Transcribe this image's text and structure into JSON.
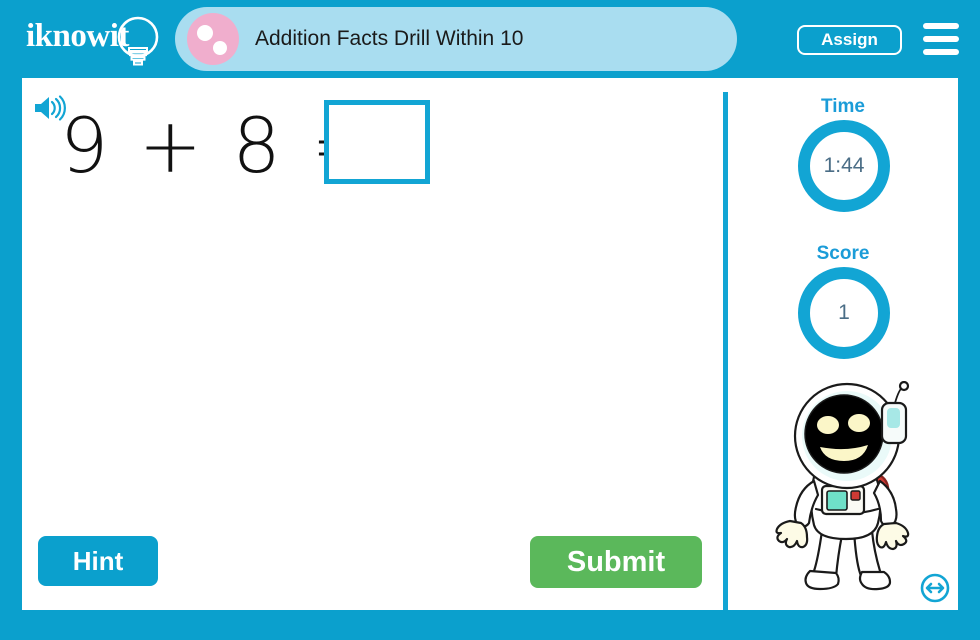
{
  "brand": {
    "logo_text": "iknowit",
    "logo_icon": "lightbulb-icon"
  },
  "header": {
    "title": "Addition Facts Drill Within 10",
    "title_icon": "pink-circle-dots-icon",
    "assign_label": "Assign",
    "menu_icon": "hamburger-menu-icon",
    "bar_color": "#0ba0cd",
    "title_pill_color": "#a9ddf0",
    "title_icon_color": "#f0aecd"
  },
  "question": {
    "speaker_icon": "speaker-audio-icon",
    "equation": "9 + 8 =",
    "operand_left": "9",
    "operator": "+",
    "operand_right": "8",
    "equals": "=",
    "answer_value": "",
    "answer_placeholder": ""
  },
  "actions": {
    "hint_label": "Hint",
    "hint_color": "#0ba0cd",
    "submit_label": "Submit",
    "submit_color": "#5bb85b"
  },
  "sidebar": {
    "time_label": "Time",
    "time_value": "1:44",
    "score_label": "Score",
    "score_value": "1",
    "ring_color": "#12a5d4",
    "label_color": "#1b9cd8",
    "mascot_icon": "astronaut-mascot-icon",
    "fullscreen_icon": "resize-horizontal-arrows-icon"
  }
}
